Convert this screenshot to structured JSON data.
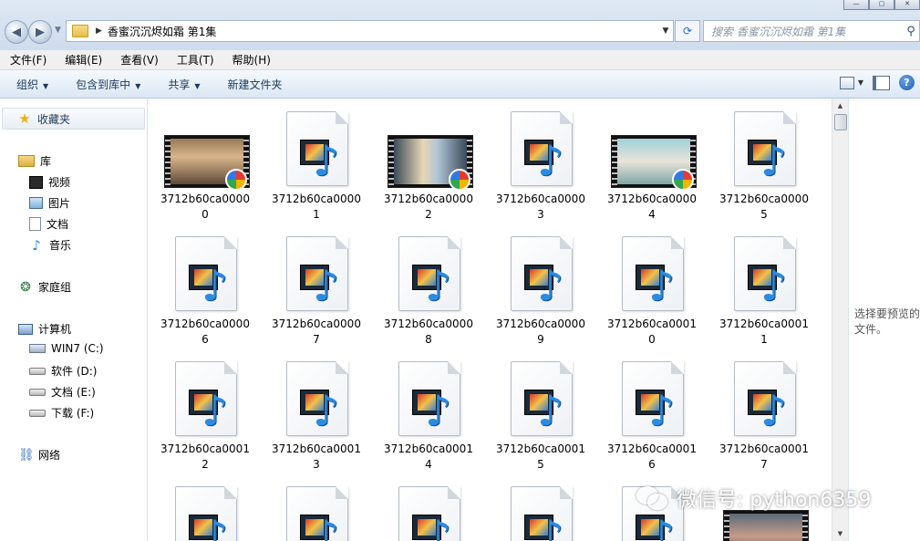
{
  "address": {
    "path_segment": "香蜜沉沉烬如霜 第1集",
    "search_placeholder": "搜索 香蜜沉沉烬如霜 第1集"
  },
  "menu": [
    "文件(F)",
    "编辑(E)",
    "查看(V)",
    "工具(T)",
    "帮助(H)"
  ],
  "commands": {
    "organize": "组织",
    "include_in_library": "包含到库中",
    "share": "共享",
    "new_folder": "新建文件夹"
  },
  "nav": {
    "favorites": "收藏夹",
    "libraries": "库",
    "videos": "视频",
    "pictures": "图片",
    "documents": "文档",
    "music": "音乐",
    "homegroup": "家庭组",
    "computer": "计算机",
    "drive_c": "WIN7 (C:)",
    "drive_d": "软件 (D:)",
    "drive_e": "文档 (E:)",
    "drive_f": "下载 (F:)",
    "network": "网络"
  },
  "files": [
    {
      "line1": "3712b60ca0000",
      "line2": "0",
      "type": "video",
      "style": "vi-1"
    },
    {
      "line1": "3712b60ca0000",
      "line2": "1",
      "type": "audio"
    },
    {
      "line1": "3712b60ca0000",
      "line2": "2",
      "type": "video",
      "style": "vi-2"
    },
    {
      "line1": "3712b60ca0000",
      "line2": "3",
      "type": "audio"
    },
    {
      "line1": "3712b60ca0000",
      "line2": "4",
      "type": "video",
      "style": "vi-3"
    },
    {
      "line1": "3712b60ca0000",
      "line2": "5",
      "type": "audio"
    },
    {
      "line1": "3712b60ca0000",
      "line2": "6",
      "type": "audio"
    },
    {
      "line1": "3712b60ca0000",
      "line2": "7",
      "type": "audio"
    },
    {
      "line1": "3712b60ca0000",
      "line2": "8",
      "type": "audio"
    },
    {
      "line1": "3712b60ca0000",
      "line2": "9",
      "type": "audio"
    },
    {
      "line1": "3712b60ca0001",
      "line2": "0",
      "type": "audio"
    },
    {
      "line1": "3712b60ca0001",
      "line2": "1",
      "type": "audio"
    },
    {
      "line1": "3712b60ca0001",
      "line2": "2",
      "type": "audio"
    },
    {
      "line1": "3712b60ca0001",
      "line2": "3",
      "type": "audio"
    },
    {
      "line1": "3712b60ca0001",
      "line2": "4",
      "type": "audio"
    },
    {
      "line1": "3712b60ca0001",
      "line2": "5",
      "type": "audio"
    },
    {
      "line1": "3712b60ca0001",
      "line2": "6",
      "type": "audio"
    },
    {
      "line1": "3712b60ca0001",
      "line2": "7",
      "type": "audio"
    },
    {
      "line1": "",
      "line2": "",
      "type": "audio"
    },
    {
      "line1": "",
      "line2": "",
      "type": "audio"
    },
    {
      "line1": "",
      "line2": "",
      "type": "audio"
    },
    {
      "line1": "",
      "line2": "",
      "type": "audio"
    },
    {
      "line1": "",
      "line2": "",
      "type": "audio"
    },
    {
      "line1": "",
      "line2": "",
      "type": "video",
      "style": "vi-4"
    }
  ],
  "preview": {
    "message": "选择要预览的文件。"
  },
  "watermark": {
    "text": "微信号: python6359"
  }
}
